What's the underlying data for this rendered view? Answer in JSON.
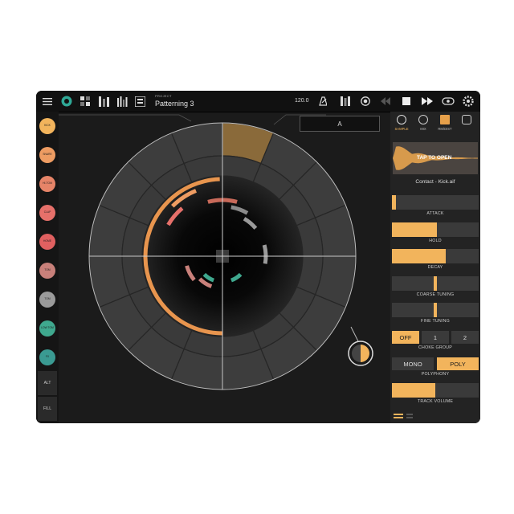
{
  "header": {
    "project_label": "PROJECT",
    "project_name": "Patterning 3",
    "tempo": "120.0"
  },
  "tracks": [
    {
      "label": "KICK",
      "color": "#f2b45c"
    },
    {
      "label": "SNARE",
      "color": "#ee9c62"
    },
    {
      "label": "HI-TOM",
      "color": "#e68468"
    },
    {
      "label": "CLAP",
      "color": "#e6706a"
    },
    {
      "label": "HOME",
      "color": "#e06060"
    },
    {
      "label": "TOM",
      "color": "#c8807a"
    },
    {
      "label": "TOM",
      "color": "#9a9a9a"
    },
    {
      "label": "LOW TOM",
      "color": "#3fa88e"
    },
    {
      "label": "FX",
      "color": "#3a9a92"
    }
  ],
  "side_buttons": {
    "alt": "ALT",
    "fill": "FILL"
  },
  "pattern_box": "A",
  "panel": {
    "tabs": [
      "SAMPLE",
      "MIX",
      "RM/DIST"
    ],
    "waveform_label": "TAP TO OPEN",
    "sample_file": "Contact - Kick.aif",
    "attack": {
      "label": "ATTACK",
      "value": 0.05
    },
    "hold": {
      "label": "HOLD",
      "value": 0.52
    },
    "decay": {
      "label": "DECAY",
      "value": 0.62
    },
    "coarse": {
      "label": "COARSE TUNING",
      "value": 0.5
    },
    "fine": {
      "label": "FINE TUNING",
      "value": 0.5
    },
    "choke": {
      "label": "CHOKE GROUP",
      "options": [
        "OFF",
        "1",
        "2"
      ],
      "selected": "OFF"
    },
    "polyphony": {
      "label": "POLYPHONY",
      "options": [
        "MONO",
        "POLY"
      ],
      "selected": "POLY"
    },
    "volume": {
      "label": "TRACK VOLUME",
      "value": 0.5
    }
  },
  "colors": {
    "accent": "#f2b45c",
    "background": "#1b1b1b"
  }
}
